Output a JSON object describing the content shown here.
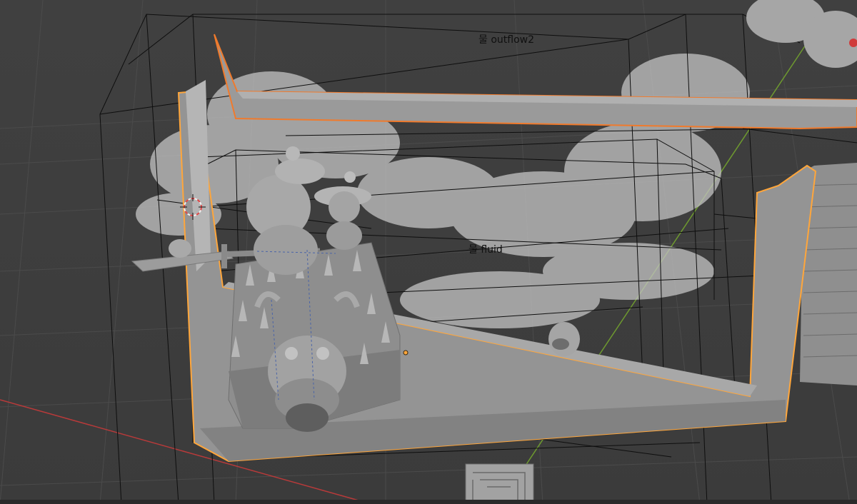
{
  "viewport": {
    "labels": {
      "outflow": "물 outflow2",
      "fluid": "물 fluid"
    }
  },
  "colors": {
    "background": "#3d3d3d",
    "grid": "#4a4a4a",
    "wireframe": "#0e0e0e",
    "selection_active": "#ffa63b",
    "selection": "#f07a2c",
    "mesh": "#9a9a9a",
    "x_axis": "#b83a3a",
    "y_axis": "#6e9a2f",
    "cloud": "#c9c9c9"
  },
  "icons": [
    "3d-cursor-icon",
    "origin-point-icon"
  ]
}
